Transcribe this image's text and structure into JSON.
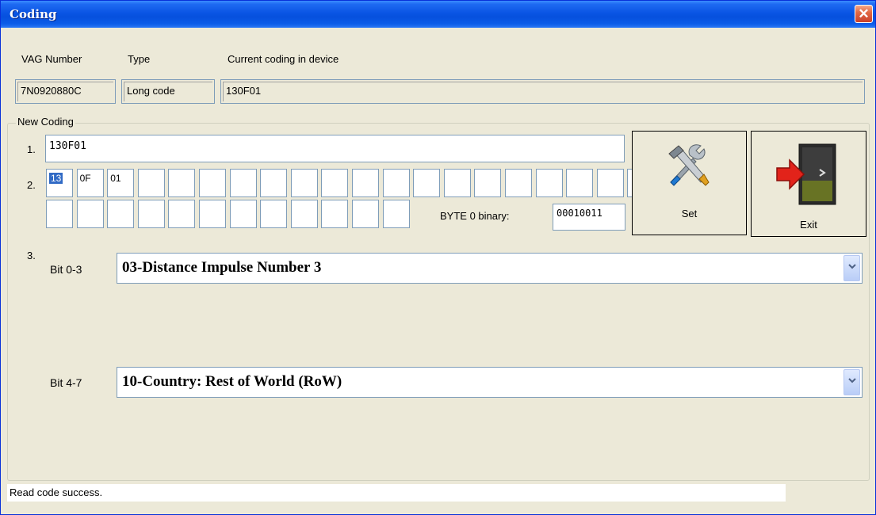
{
  "window": {
    "title": "Coding",
    "close_glyph": "✕"
  },
  "header": {
    "vag_label": "VAG Number",
    "type_label": "Type",
    "current_label": "Current coding in device",
    "vag_value": "7N0920880C",
    "type_value": "Long code",
    "current_value": "130F01"
  },
  "new_coding": {
    "legend": "New Coding",
    "row1_label": "1.",
    "row1_value": "130F01",
    "row2_label": "2.",
    "bytes_row1": [
      "13",
      "0F",
      "01",
      "",
      "",
      "",
      "",
      "",
      "",
      "",
      "",
      "",
      "",
      "",
      "",
      "",
      "",
      "",
      "",
      ""
    ],
    "bytes_row2": [
      "",
      "",
      "",
      "",
      "",
      "",
      "",
      "",
      "",
      "",
      "",
      ""
    ],
    "selected_byte": "13",
    "byte_binary_label": "BYTE 0 binary:",
    "byte_binary_value": "00010011",
    "row3_label": "3.",
    "bit03_label": "Bit 0-3",
    "bit03_value": "03-Distance Impulse Number 3",
    "bit47_label": "Bit 4-7",
    "bit47_value": "10-Country: Rest of World (RoW)"
  },
  "buttons": {
    "set_label": "Set",
    "exit_label": "Exit"
  },
  "status": {
    "text": "Read code success."
  },
  "icons": {
    "set": "tools-icon",
    "exit": "exit-door-icon",
    "dropdown": "chevron-down-icon"
  }
}
